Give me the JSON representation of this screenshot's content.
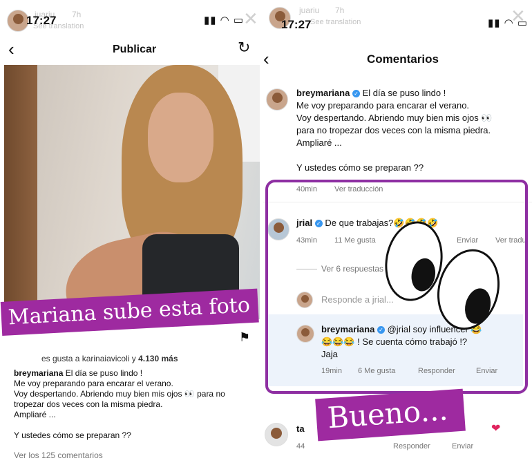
{
  "left": {
    "story_user": "juariu",
    "story_age": "7h",
    "see_translation": "See translation",
    "time": "17:27",
    "title": "Publicar",
    "overlay_text": "Mariana sube esta foto",
    "likes_partial": "es gusta a",
    "likes_user": "karinaiavicoli",
    "likes_connector": "y",
    "likes_count": "4.130 más",
    "caption_user": "breymariana",
    "caption_lines": [
      "El día se puso lindo !",
      "Me voy preparando para encarar el verano.",
      "Voy despertando. Abriendo muy bien mis ojos 👀 para no",
      "tropezar dos veces con la misma piedra.",
      "Ampliaré ...",
      "",
      "Y ustedes cómo se preparan ??"
    ],
    "view_comments": "Ver los 125 comentarios"
  },
  "right": {
    "story_user": "juariu",
    "story_age": "7h",
    "see_translation": "See translation",
    "time": "17:27",
    "title": "Comentarios",
    "post": {
      "user": "breymariana",
      "lines": [
        "El día se puso lindo !",
        "Me voy preparando para encarar el verano.",
        "Voy despertando. Abriendo muy bien mis ojos 👀",
        "para no tropezar dos veces con la misma piedra.",
        "Ampliaré ...",
        "",
        "Y ustedes cómo se preparan ??"
      ],
      "age": "40min",
      "translate": "Ver traducción"
    },
    "comment1": {
      "user": "jrial",
      "text": "De que trabajas?🤣🤣🤣🤣",
      "age": "43min",
      "likes": "11 Me gusta",
      "send": "Enviar",
      "translate": "Ver tradu"
    },
    "view_replies": "Ver 6 respuestas",
    "reply_placeholder": "Responde a jrial...",
    "reply": {
      "user": "breymariana",
      "text_line1": "@jrial soy influencer 😂",
      "text_line2": "😂😂😂 ! Se cuenta cómo trabajó !?",
      "text_line3": "Jaja",
      "age": "19min",
      "likes": "6 Me gusta",
      "reply_btn": "Responder",
      "send": "Enviar"
    },
    "bottom": {
      "user_partial": "ta",
      "age": "44",
      "reply_btn": "Responder",
      "send": "Enviar"
    },
    "overlay_text": "Bueno..."
  }
}
